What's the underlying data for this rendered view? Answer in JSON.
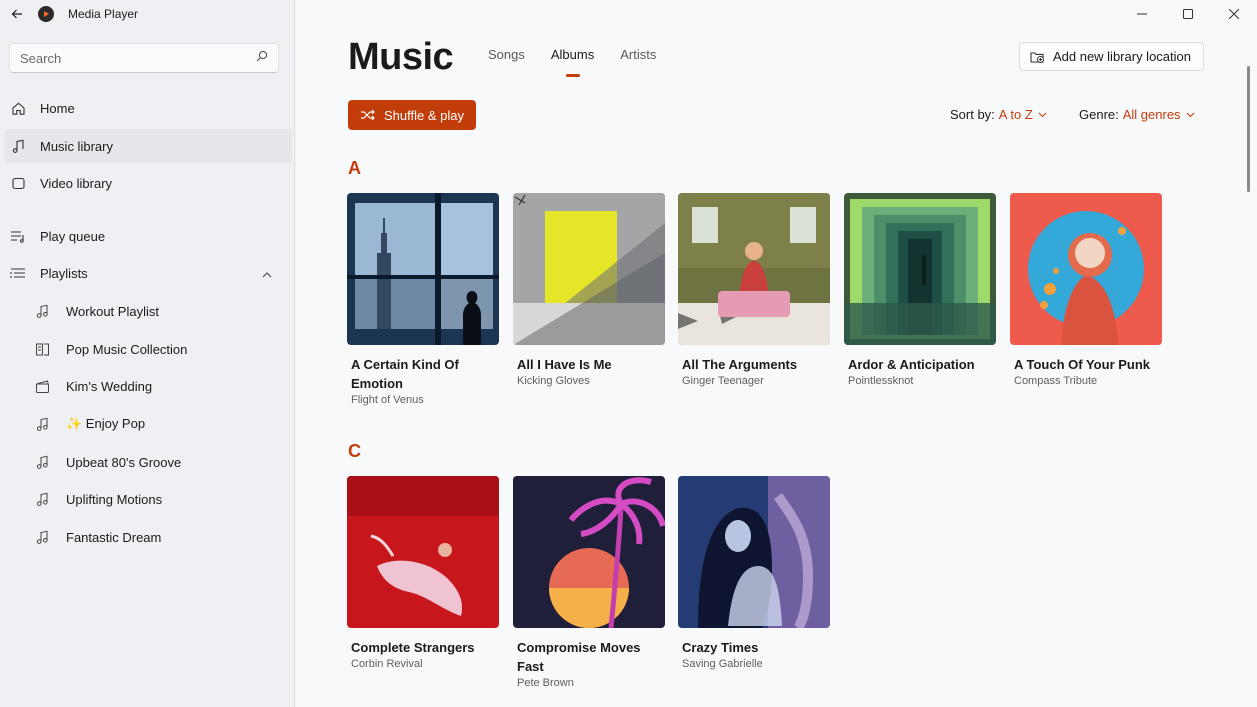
{
  "app": {
    "title": "Media Player"
  },
  "search": {
    "placeholder": "Search"
  },
  "nav": {
    "home": "Home",
    "music_library": "Music library",
    "video_library": "Video library",
    "play_queue": "Play queue",
    "playlists": "Playlists"
  },
  "playlists": [
    {
      "label": "Workout Playlist",
      "icon": "music-note-icon"
    },
    {
      "label": "Pop Music Collection",
      "icon": "album-collection-icon"
    },
    {
      "label": "Kim's Wedding",
      "icon": "clapperboard-icon"
    },
    {
      "label": "✨ Enjoy Pop",
      "icon": "music-note-icon"
    },
    {
      "label": "Upbeat 80's Groove",
      "icon": "music-note-icon"
    },
    {
      "label": "Uplifting Motions",
      "icon": "music-note-icon"
    },
    {
      "label": "Fantastic Dream",
      "icon": "music-note-icon"
    }
  ],
  "header": {
    "title": "Music",
    "tabs": [
      "Songs",
      "Albums",
      "Artists"
    ],
    "active_tab": "Albums",
    "add_location": "Add new library location"
  },
  "toolbar": {
    "shuffle": "Shuffle & play",
    "sort_label": "Sort by:",
    "sort_value": "A to Z",
    "genre_label": "Genre:",
    "genre_value": "All genres"
  },
  "sections": [
    {
      "letter": "A",
      "albums": [
        {
          "title": "A Certain Kind Of Emotion",
          "artist": "Flight of Venus"
        },
        {
          "title": "All I Have Is Me",
          "artist": "Kicking Gloves"
        },
        {
          "title": "All The Arguments",
          "artist": "Ginger Teenager"
        },
        {
          "title": "Ardor & Anticipation",
          "artist": "Pointlessknot"
        },
        {
          "title": "A Touch Of Your Punk",
          "artist": "Compass Tribute"
        }
      ]
    },
    {
      "letter": "C",
      "albums": [
        {
          "title": "Complete Strangers",
          "artist": "Corbin Revival"
        },
        {
          "title": "Compromise Moves Fast",
          "artist": "Pete Brown"
        },
        {
          "title": "Crazy Times",
          "artist": "Saving Gabrielle"
        }
      ]
    }
  ],
  "colors": {
    "accent": "#c33d0b",
    "sidebar_bg": "#eef0f4",
    "main_bg": "#f8f9fb"
  }
}
